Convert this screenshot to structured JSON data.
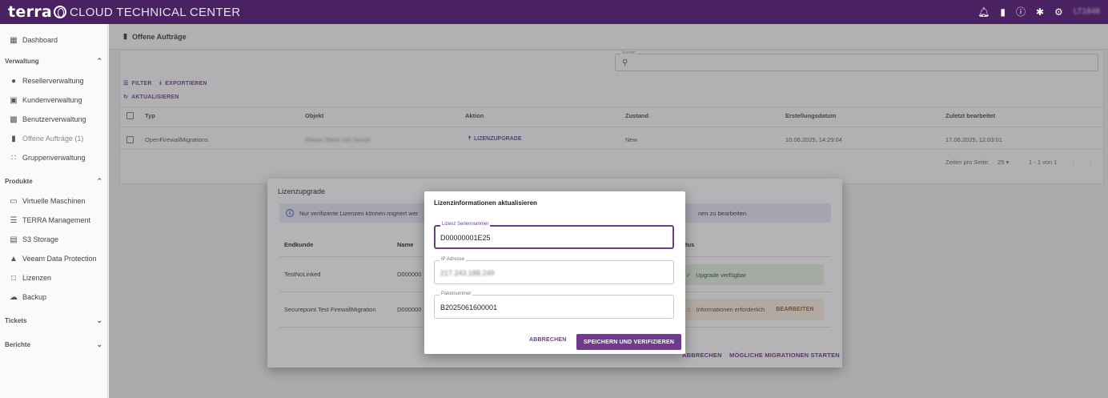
{
  "app": {
    "brand": "terra",
    "brand_sub": "CLOUD TECHNICAL CENTER",
    "user": "LT1848"
  },
  "sidebar": {
    "dashboard": "Dashboard",
    "section_verwaltung": "Verwaltung",
    "items_verwaltung": [
      "Resellerverwaltung",
      "Kundenverwaltung",
      "Benutzerverwaltung",
      "Offene Aufträge (1)",
      "Gruppenverwaltung"
    ],
    "section_produkte": "Produkte",
    "items_produkte": [
      "Virtuelle Maschinen",
      "TERRA Management",
      "S3 Storage",
      "Veeam Data Protection",
      "Lizenzen",
      "Backup"
    ],
    "section_tickets": "Tickets",
    "section_berichte": "Berichte"
  },
  "page": {
    "title": "Offene Aufträge",
    "search_label": "Suchen",
    "filter": "FILTER",
    "export": "EXPORTIEREN",
    "refresh": "AKTUALISIEREN",
    "columns": [
      "Typ",
      "Objekt",
      "Aktion",
      "Zustand",
      "Erstellungsdatum",
      "Zuletzt bearbeitet"
    ],
    "row": {
      "typ": "OpenFirewallMigrations",
      "objekt": "Florian Stock von Securi",
      "aktion": "LIZENZUPGRADE",
      "zustand": "New",
      "erstellt": "10.06.2025, 14:29:04",
      "bearbeitet": "17.06.2025, 12:03:01"
    },
    "pager": {
      "rows_label": "Zeilen pro Seite:",
      "rows_value": "25",
      "range": "1 - 1 von 1"
    }
  },
  "migration_dialog": {
    "title": "Lizenzupgrade",
    "info_left": "Nur verifizierte Lizenzen können migriert wer",
    "info_right": "nen zu bearbeiten.",
    "columns": [
      "Endkunde",
      "Name",
      "tus"
    ],
    "rows": [
      {
        "endkunde": "TestNoLinked",
        "name": "D000000",
        "status": "Upgrade verfügbar"
      },
      {
        "endkunde": "Securepoint Test FirewallMigration",
        "name": "D000000",
        "status": "Informationen erforderlich",
        "action": "BEARBEITEN"
      }
    ],
    "cancel": "ABBRECHEN",
    "start": "MÖGLICHE MIGRATIONEN STARTEN"
  },
  "license_dialog": {
    "title": "Lizenzinformationen aktualisieren",
    "fields": [
      {
        "label": "Lizenz Seriennummer",
        "value": "D00000001E25"
      },
      {
        "label": "IP Adresse",
        "value": "217.243.188.249"
      },
      {
        "label": "Paketnummer",
        "value": "B2025061600001"
      }
    ],
    "cancel": "ABBRECHEN",
    "save": "SPEICHERN UND VERIFIZIEREN"
  },
  "colors": {
    "brand": "#4a2161",
    "accent": "#6f3b8b"
  }
}
